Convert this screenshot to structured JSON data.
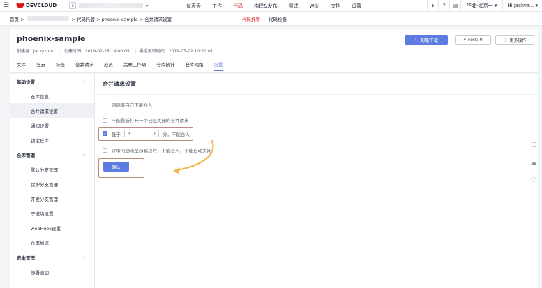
{
  "topbar": {
    "brand": "DEVCLOUD",
    "nav": [
      {
        "label": "仪表盘",
        "active": false
      },
      {
        "label": "工作",
        "active": false
      },
      {
        "label": "代码",
        "active": true
      },
      {
        "label": "构建&发布",
        "active": false
      },
      {
        "label": "测试",
        "active": false
      },
      {
        "label": "Wiki",
        "active": false
      },
      {
        "label": "文档",
        "active": false
      },
      {
        "label": "设置",
        "active": false
      }
    ],
    "region": "华北-北京一",
    "user": "Hi jackyz..."
  },
  "breadcrumb": {
    "home": "首页 >",
    "rest": "> 代码托管 > phoenix-sample > 合并请求设置",
    "subtabs": [
      {
        "label": "代码托管",
        "active": true
      },
      {
        "label": "代码检查",
        "active": false
      }
    ]
  },
  "repo": {
    "name": "phoenix-sample",
    "creator_label": "创建者:",
    "creator": "jackyzhou",
    "created_label": "创建时间:",
    "created": "2019-02-28 14:00:05",
    "updated_label": "最近更新时间:",
    "updated": "2019-03-12 10:30:01",
    "clone_label": "克隆/下载",
    "fork_label": "Fork: 0",
    "more_label": "更多操作",
    "tabs": [
      {
        "label": "文件",
        "active": false
      },
      {
        "label": "分支",
        "active": false
      },
      {
        "label": "标签",
        "active": false
      },
      {
        "label": "合并请求",
        "active": false
      },
      {
        "label": "成员",
        "active": false
      },
      {
        "label": "关联工作项",
        "active": false
      },
      {
        "label": "仓库统计",
        "active": false
      },
      {
        "label": "仓库网络",
        "active": false
      },
      {
        "label": "设置",
        "active": true
      }
    ]
  },
  "sidebar": {
    "groups": [
      {
        "label": "基础设置",
        "items": [
          {
            "label": "仓库信息",
            "active": false
          },
          {
            "label": "合并请求设置",
            "active": true
          },
          {
            "label": "通知设置",
            "active": false
          },
          {
            "label": "锁定仓库",
            "active": false
          }
        ]
      },
      {
        "label": "仓库管理",
        "items": [
          {
            "label": "默认分支管理",
            "active": false
          },
          {
            "label": "保护分支管理",
            "active": false
          },
          {
            "label": "开发分支管理",
            "active": false
          },
          {
            "label": "子模块设置",
            "active": false
          },
          {
            "label": "webHook设置",
            "active": false
          },
          {
            "label": "仓库加速",
            "active": false
          }
        ]
      },
      {
        "label": "安全管理",
        "items": [
          {
            "label": "部署密钥",
            "active": false
          }
        ]
      }
    ]
  },
  "content": {
    "title": "合并请求设置",
    "options": [
      {
        "label": "创建者自己不能合入",
        "checked": false
      },
      {
        "label": "不能重新打开一个已经关闭的合并请求",
        "checked": false
      }
    ],
    "score_option": {
      "prefix": "低于",
      "value": "3",
      "suffix": "分，不能合入",
      "checked": true
    },
    "review_option": {
      "label": "评审问题未全部解决时，不能合入，不能自动关闭",
      "checked": false
    },
    "confirm_label": "确认"
  },
  "colors": {
    "accent": "#5e7ce0",
    "brand_red": "#d4161c",
    "highlight": "#b98a82",
    "arrow": "#f0b64a"
  }
}
